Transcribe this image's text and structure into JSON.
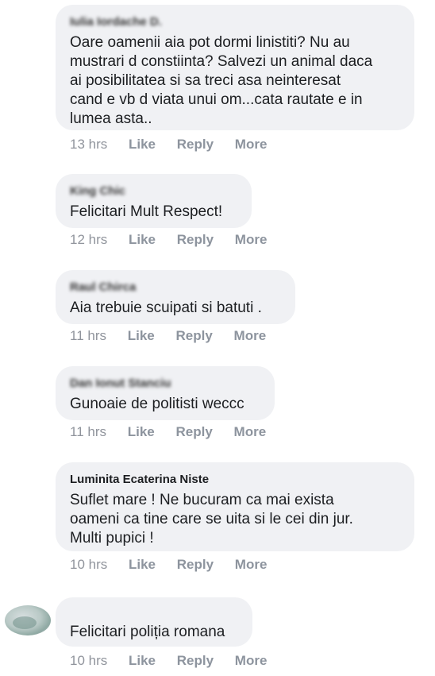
{
  "comments": [
    {
      "author": "Iulia Iordache D.",
      "text": "Oare oamenii aia pot dormi linistiti? Nu au\nmustrari d constiinta? Salvezi un animal daca\nai posibilitatea si sa treci asa neinteresat\ncand e vb d viata unui om...cata rautate e in\nlumea asta..",
      "time": "13 hrs"
    },
    {
      "author": "King Chic",
      "text": "Felicitari Mult Respect!",
      "time": "12 hrs"
    },
    {
      "author": "Raul Chirca",
      "text": "Aia trebuie scuipati si batuti .",
      "time": "11 hrs"
    },
    {
      "author": "Dan Ionut Stanciu",
      "text": "Gunoaie de politisti weccc",
      "time": "11 hrs"
    },
    {
      "author": "Luminita Ecaterina Niste",
      "text": "Suflet mare ! Ne bucuram ca mai exista\noameni ca tine care se uita si le cei din jur.\nMulti pupici !",
      "time": "10 hrs"
    },
    {
      "author": "",
      "text": "Felicitari poliția romana",
      "time": "10 hrs"
    }
  ],
  "actions": {
    "like": "Like",
    "reply": "Reply",
    "more": "More"
  }
}
